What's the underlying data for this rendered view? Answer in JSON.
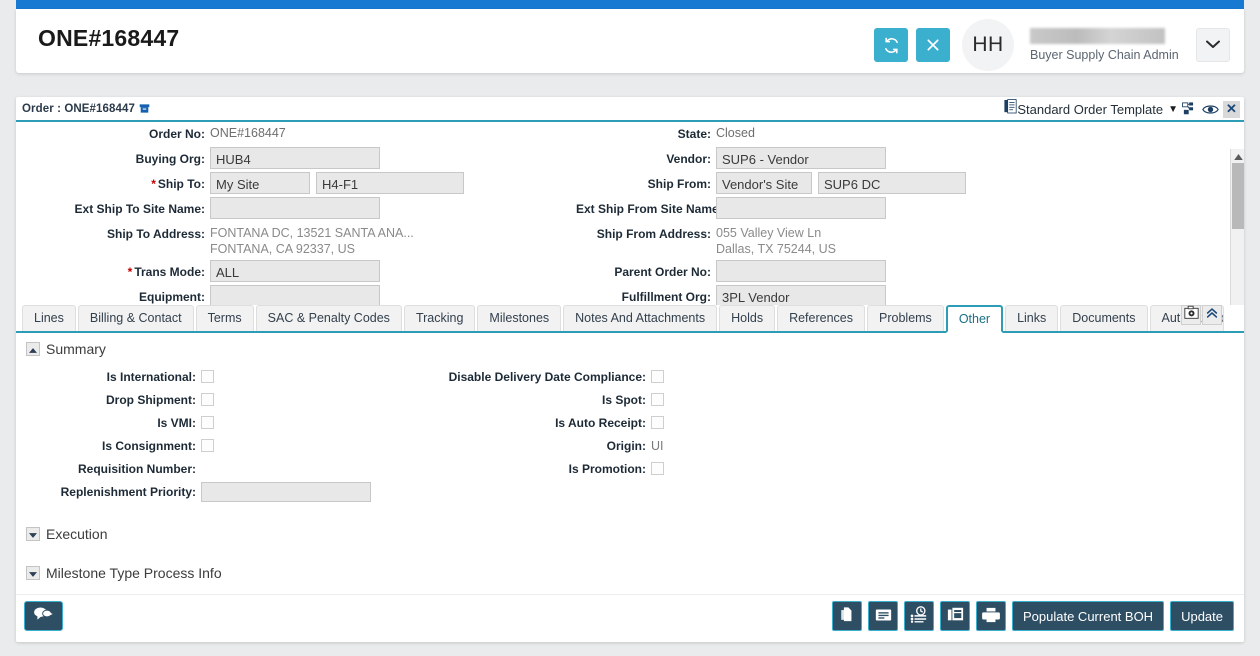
{
  "header": {
    "title": "ONE#168447",
    "refresh_icon": "refresh-icon",
    "close_icon": "close-icon",
    "avatar_initials": "HH",
    "user_role": "Buyer Supply Chain Admin",
    "caret_icon": "chevron-down-icon",
    "accent_blue": "#1879d3",
    "accent_teal": "#3aafce"
  },
  "panel": {
    "title": "Order : ONE#168447",
    "title_icon": "archive-box-icon",
    "template_label": "Standard Order Template",
    "template_icon": "document-template-icon",
    "template_caret": "▼",
    "hierarchy_icon": "hierarchy-icon",
    "eye_icon": "eye-icon",
    "close_label": "✕",
    "border_teal": "#2d9cb5"
  },
  "form": {
    "left": [
      {
        "label": "Order No:",
        "required": false,
        "type": "text",
        "value": "ONE#168447"
      },
      {
        "label": "Buying Org:",
        "required": false,
        "type": "box",
        "value": "HUB4"
      },
      {
        "label": "Ship To:",
        "required": true,
        "type": "box2",
        "value": "My Site",
        "value2": "H4-F1"
      },
      {
        "label": "Ext Ship To Site Name:",
        "required": false,
        "type": "box",
        "value": ""
      },
      {
        "label": "Ship To Address:",
        "required": false,
        "type": "address",
        "line1": "FONTANA DC, 13521 SANTA ANA...",
        "line2": "FONTANA, CA 92337, US"
      },
      {
        "label": "Trans Mode:",
        "required": true,
        "type": "box",
        "value": "ALL"
      },
      {
        "label": "Equipment:",
        "required": false,
        "type": "box",
        "value": ""
      }
    ],
    "right": [
      {
        "label": "State:",
        "required": false,
        "type": "text",
        "value": "Closed"
      },
      {
        "label": "Vendor:",
        "required": false,
        "type": "box",
        "value": "SUP6 - Vendor"
      },
      {
        "label": "Ship From:",
        "required": false,
        "type": "box2",
        "value": "Vendor's Site",
        "value2": "SUP6 DC"
      },
      {
        "label": "Ext Ship From Site Name:",
        "required": false,
        "type": "box",
        "value": ""
      },
      {
        "label": "Ship From Address:",
        "required": false,
        "type": "address",
        "line1": "055 Valley View Ln",
        "line2": "Dallas, TX 75244, US"
      },
      {
        "label": "Parent Order No:",
        "required": false,
        "type": "box",
        "value": ""
      },
      {
        "label": "Fulfillment Org:",
        "required": false,
        "type": "box",
        "value": "3PL Vendor"
      }
    ]
  },
  "tabs": [
    {
      "label": "Lines",
      "active": false
    },
    {
      "label": "Billing & Contact",
      "active": false
    },
    {
      "label": "Terms",
      "active": false
    },
    {
      "label": "SAC & Penalty Codes",
      "active": false
    },
    {
      "label": "Tracking",
      "active": false
    },
    {
      "label": "Milestones",
      "active": false
    },
    {
      "label": "Notes And Attachments",
      "active": false
    },
    {
      "label": "Holds",
      "active": false
    },
    {
      "label": "References",
      "active": false
    },
    {
      "label": "Problems",
      "active": false
    },
    {
      "label": "Other",
      "active": true
    },
    {
      "label": "Links",
      "active": false
    },
    {
      "label": "Documents",
      "active": false
    },
    {
      "label": "Authorization",
      "active": false
    }
  ],
  "tab_overlay": {
    "settings_icon": "settings-gear-icon",
    "collapse_icon": "chevrons-up-icon"
  },
  "sections": {
    "summary": {
      "title": "Summary",
      "expanded": true,
      "toggle_icon": "caret-up-icon",
      "left_fields": [
        {
          "label": "Is International:",
          "type": "checkbox",
          "checked": false
        },
        {
          "label": "Drop Shipment:",
          "type": "checkbox",
          "checked": false
        },
        {
          "label": "Is VMI:",
          "type": "checkbox",
          "checked": false
        },
        {
          "label": "Is Consignment:",
          "type": "checkbox",
          "checked": false
        },
        {
          "label": "Requisition Number:",
          "type": "text",
          "value": ""
        },
        {
          "label": "Replenishment Priority:",
          "type": "box",
          "value": ""
        }
      ],
      "right_fields": [
        {
          "label": "Disable Delivery Date Compliance:",
          "type": "checkbox",
          "checked": false
        },
        {
          "label": "Is Spot:",
          "type": "checkbox",
          "checked": false
        },
        {
          "label": "Is Auto Receipt:",
          "type": "checkbox",
          "checked": false
        },
        {
          "label": "Origin:",
          "type": "text",
          "value": "UI"
        },
        {
          "label": "Is Promotion:",
          "type": "checkbox",
          "checked": false
        }
      ]
    },
    "execution": {
      "title": "Execution",
      "expanded": false,
      "toggle_icon": "caret-down-icon"
    },
    "milestone": {
      "title": "Milestone Type Process Info",
      "expanded": false,
      "toggle_icon": "caret-down-icon"
    }
  },
  "footer": {
    "chat_icon": "chat-bubbles-icon",
    "buttons": [
      {
        "label": "",
        "icon": "copy-pages-icon",
        "icon_only": true
      },
      {
        "label": "",
        "icon": "message-card-icon",
        "icon_only": true
      },
      {
        "label": "",
        "icon": "history-clock-icon",
        "icon_only": true
      },
      {
        "label": "",
        "icon": "duplicate-window-icon",
        "icon_only": true
      },
      {
        "label": "",
        "icon": "printer-icon",
        "icon_only": true
      },
      {
        "label": "Populate Current BOH",
        "icon": "",
        "icon_only": false
      },
      {
        "label": "Update",
        "icon": "",
        "icon_only": false
      }
    ],
    "button_bg": "#2e4e64"
  },
  "scrollbar": {
    "up_icon": "triangle-up-icon",
    "down_icon": "triangle-down-icon"
  }
}
